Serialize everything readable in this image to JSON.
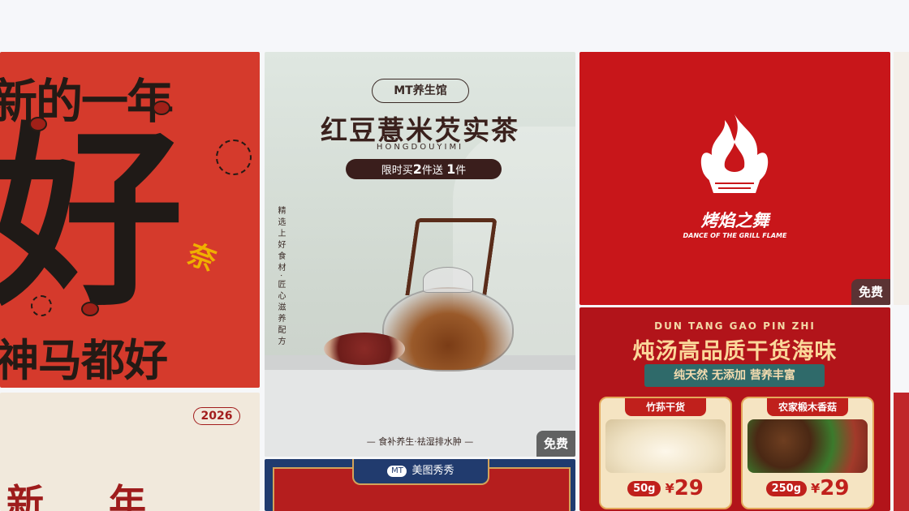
{
  "cards": {
    "new_year": {
      "line1": "新的一年",
      "big_char": "好",
      "line2": "神马都好",
      "seal": "奈"
    },
    "tea": {
      "brand": "MT养生馆",
      "title": "红豆薏米芡实茶",
      "pinyin": "HONGDOUYIMI",
      "promo_prefix": "限时买",
      "promo_n1": "2",
      "promo_mid": "件送",
      "promo_n2": "1",
      "promo_suffix": "件",
      "side_text": "精选上好食材·匠心滋养配方",
      "footer": "— 食补养生·祛湿排水肿 —",
      "badge": "免费"
    },
    "grill": {
      "name": "烤焰之舞",
      "en": "DANCE OF THE GRILL FLAME",
      "badge": "免费",
      "color": "#c8161a"
    },
    "soup": {
      "en": "DUN TANG GAO PIN ZHI",
      "title": "炖汤高品质干货海味",
      "ribbon": "纯天然 无添加 营养丰富",
      "products": [
        {
          "label": "竹荪干货",
          "weight": "50g",
          "currency": "¥",
          "price": "29"
        },
        {
          "label": "农家椴木香菇",
          "weight": "250g",
          "currency": "¥",
          "price": "29"
        }
      ]
    },
    "year2026": {
      "year": "2026",
      "brush": "新年"
    },
    "meitu": {
      "tag": "美图秀秀",
      "logo": "MT"
    }
  }
}
